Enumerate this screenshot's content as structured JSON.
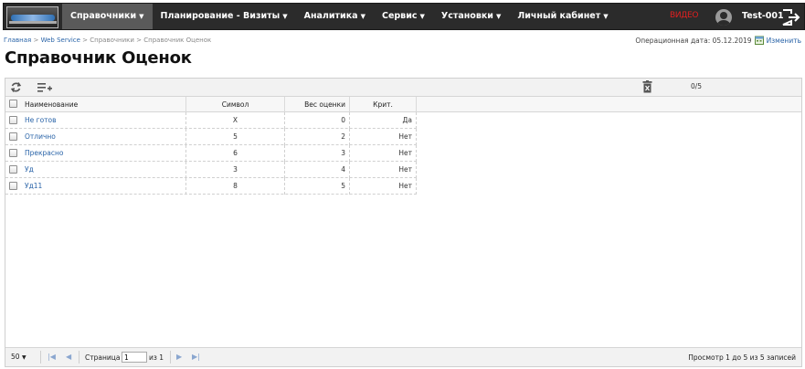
{
  "nav": {
    "items": [
      {
        "label": "Справочники",
        "active": true
      },
      {
        "label": "Планирование - Визиты",
        "active": false
      },
      {
        "label": "Аналитика",
        "active": false
      },
      {
        "label": "Сервис",
        "active": false
      },
      {
        "label": "Установки",
        "active": false
      },
      {
        "label": "Личный кабинет",
        "active": false
      }
    ],
    "video_label": "ВИДЕО",
    "username": "Test-001"
  },
  "breadcrumb": {
    "home": "Главная",
    "sep": " > ",
    "web_service": "Web Service",
    "refs": "Справочники",
    "current": "Справочник Оценок"
  },
  "opdate": {
    "label": "Операционная дата: 05.12.2019",
    "change_label": "Изменить"
  },
  "page_title": "Справочник Оценок",
  "toolbar": {
    "count": "0/5"
  },
  "table": {
    "columns": [
      "Наименование",
      "Символ",
      "Вес оценки",
      "Крит."
    ],
    "rows": [
      {
        "name": "Не готов",
        "symbol": "X",
        "weight": "0",
        "crit": "Да"
      },
      {
        "name": "Отлично",
        "symbol": "5",
        "weight": "2",
        "crit": "Нет"
      },
      {
        "name": "Прекрасно",
        "symbol": "6",
        "weight": "3",
        "crit": "Нет"
      },
      {
        "name": "Уд",
        "symbol": "3",
        "weight": "4",
        "crit": "Нет"
      },
      {
        "name": "Уд11",
        "symbol": "8",
        "weight": "5",
        "crit": "Нет"
      }
    ]
  },
  "pager": {
    "page_size": "50",
    "page_label": "Страница",
    "page_value": "1",
    "of_label": "из 1",
    "view_info": "Просмотр 1 до 5 из 5 записей"
  },
  "colors": {
    "nav_bg": "#2b2b2b",
    "nav_active": "#5a5a5a",
    "link": "#2a64a8",
    "video": "#e02020"
  }
}
